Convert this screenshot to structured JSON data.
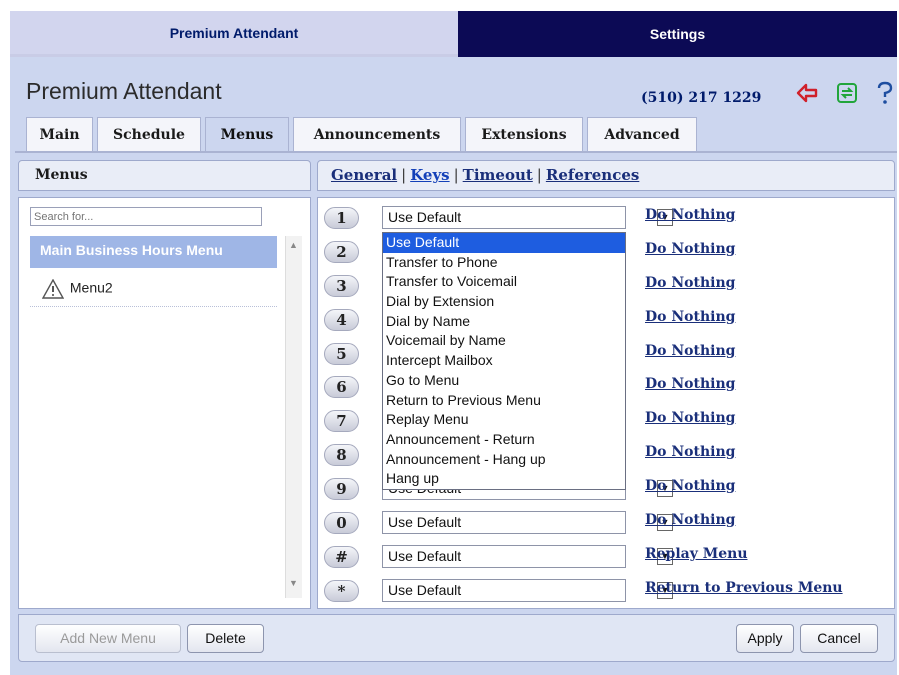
{
  "top_tabs": {
    "premium_attendant": "Premium Attendant",
    "settings": "Settings"
  },
  "header": {
    "title": "Premium Attendant",
    "phone": "(510) 217 1229",
    "icons": [
      "exit-icon",
      "refresh-icon",
      "help-icon"
    ]
  },
  "tabs": [
    {
      "label": "Main"
    },
    {
      "label": "Schedule"
    },
    {
      "label": "Menus"
    },
    {
      "label": "Announcements"
    },
    {
      "label": "Extensions"
    },
    {
      "label": "Advanced"
    }
  ],
  "active_tab": "Menus",
  "left_panel": {
    "heading": "Menus",
    "search_placeholder": "Search for...",
    "items": [
      {
        "label": "Main Business Hours Menu",
        "selected": true
      },
      {
        "label": "Menu2",
        "icon": "warning-icon"
      }
    ]
  },
  "right_panel": {
    "links": [
      "General",
      "Keys",
      "Timeout",
      "References"
    ],
    "active_link": "Keys",
    "keys": [
      {
        "key": "1",
        "value": "Use Default",
        "action": "Do Nothing"
      },
      {
        "key": "2",
        "value": "Use Default",
        "action": "Do Nothing"
      },
      {
        "key": "3",
        "value": "Use Default",
        "action": "Do Nothing"
      },
      {
        "key": "4",
        "value": "Use Default",
        "action": "Do Nothing"
      },
      {
        "key": "5",
        "value": "Use Default",
        "action": "Do Nothing"
      },
      {
        "key": "6",
        "value": "Use Default",
        "action": "Do Nothing"
      },
      {
        "key": "7",
        "value": "Use Default",
        "action": "Do Nothing"
      },
      {
        "key": "8",
        "value": "Use Default",
        "action": "Do Nothing"
      },
      {
        "key": "9",
        "value": "Use Default",
        "action": "Do Nothing"
      },
      {
        "key": "0",
        "value": "Use Default",
        "action": "Do Nothing"
      },
      {
        "key": "#",
        "value": "Use Default",
        "action": "Replay Menu"
      },
      {
        "key": "*",
        "value": "Use Default",
        "action": "Return to Previous Menu"
      }
    ],
    "dropdown_options": [
      "Use Default",
      "Transfer to Phone",
      "Transfer to Voicemail",
      "Dial by Extension",
      "Dial by Name",
      "Voicemail by Name",
      "Intercept Mailbox",
      "Go to Menu",
      "Return to Previous Menu",
      "Replay Menu",
      "Announcement - Return",
      "Announcement - Hang up",
      "Hang up"
    ],
    "dropdown_selected": "Use Default"
  },
  "footer": {
    "add_new_menu": "Add New Menu",
    "delete": "Delete",
    "apply": "Apply",
    "cancel": "Cancel"
  },
  "colors": {
    "top_tab_active_bg": "#d2d5ee",
    "top_tab_settings_bg": "#0c0a55",
    "panel_bg": "#ccd6ef",
    "link_color": "#1a2f7a",
    "selected_item_bg": "#9fb6e6",
    "dropdown_highlight": "#1e5de0"
  }
}
